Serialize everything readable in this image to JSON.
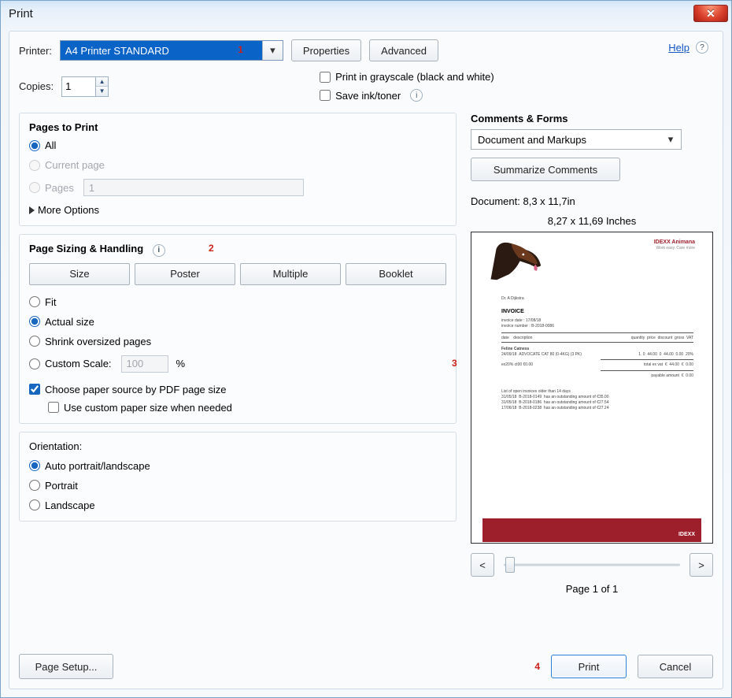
{
  "window": {
    "title": "Print"
  },
  "top": {
    "printer_label": "Printer:",
    "printer_value": "A4 Printer STANDARD",
    "properties_btn": "Properties",
    "advanced_btn": "Advanced",
    "copies_label": "Copies:",
    "copies_value": "1",
    "grayscale_label": "Print in grayscale (black and white)",
    "saveink_label": "Save ink/toner",
    "help_label": "Help"
  },
  "pages_to_print": {
    "heading": "Pages to Print",
    "all": "All",
    "current": "Current page",
    "pages": "Pages",
    "pages_value": "1",
    "more_options": "More Options"
  },
  "sizing": {
    "heading": "Page Sizing & Handling",
    "size_btn": "Size",
    "poster_btn": "Poster",
    "multiple_btn": "Multiple",
    "booklet_btn": "Booklet",
    "fit": "Fit",
    "actual": "Actual size",
    "shrink": "Shrink oversized pages",
    "custom_scale": "Custom Scale:",
    "custom_scale_value": "100",
    "custom_scale_unit": "%",
    "paper_source": "Choose paper source by PDF page size",
    "use_custom_paper": "Use custom paper size when needed"
  },
  "orientation": {
    "heading": "Orientation:",
    "auto": "Auto portrait/landscape",
    "portrait": "Portrait",
    "landscape": "Landscape"
  },
  "comments": {
    "heading": "Comments & Forms",
    "selected": "Document and Markups",
    "summarize_btn": "Summarize Comments"
  },
  "preview": {
    "doc_line": "Document: 8,3 x 11,7in",
    "page_size": "8,27 x 11,69 Inches",
    "prev": "<",
    "next": ">",
    "counter": "Page 1 of 1",
    "invoice_word": "INVOICE",
    "brand": "IDEXX Animana",
    "tagline": "Work easy. Care more"
  },
  "bottom": {
    "page_setup": "Page Setup...",
    "print": "Print",
    "cancel": "Cancel"
  },
  "markers": {
    "m1": "1",
    "m2": "2",
    "m3": "3",
    "m4": "4"
  }
}
